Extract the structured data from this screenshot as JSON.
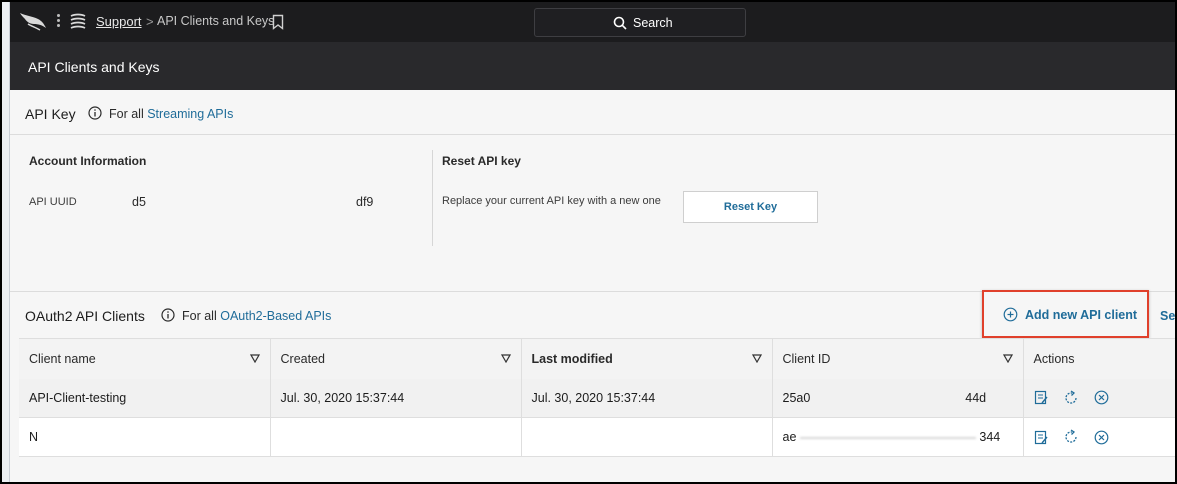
{
  "topbar": {
    "breadcrumb_link": "Support",
    "breadcrumb_separator": ">",
    "breadcrumb_current": "API Clients and Keys",
    "search_label": "Search"
  },
  "page": {
    "title": "API Clients and Keys"
  },
  "api_key": {
    "title": "API Key",
    "for_all": "For all",
    "link": "Streaming APIs",
    "account_info": {
      "heading": "Account Information",
      "uuid_label": "API UUID",
      "uuid_start": "d5",
      "uuid_end": "df9"
    },
    "reset": {
      "heading": "Reset API key",
      "description": "Replace your current API key with a new one",
      "button": "Reset Key"
    }
  },
  "oauth": {
    "title": "OAuth2 API Clients",
    "for_all": "For all",
    "link": "OAuth2-Based APIs",
    "add_button": "Add new API client",
    "see_link": "See",
    "columns": [
      "Client name",
      "Created",
      "Last modified",
      "Client ID",
      "Actions"
    ],
    "rows": [
      {
        "name": "API-Client-testing",
        "created": "Jul. 30, 2020 15:37:44",
        "modified": "Jul. 30, 2020 15:37:44",
        "id_start": "25a0",
        "id_end": "44d"
      },
      {
        "name": "N",
        "created": "",
        "modified": "",
        "id_start": "ae",
        "id_end": "344"
      }
    ]
  },
  "colors": {
    "accent_link": "#1f6c99",
    "highlight_box": "#e0402b",
    "topbar": "#1c1c1e"
  }
}
